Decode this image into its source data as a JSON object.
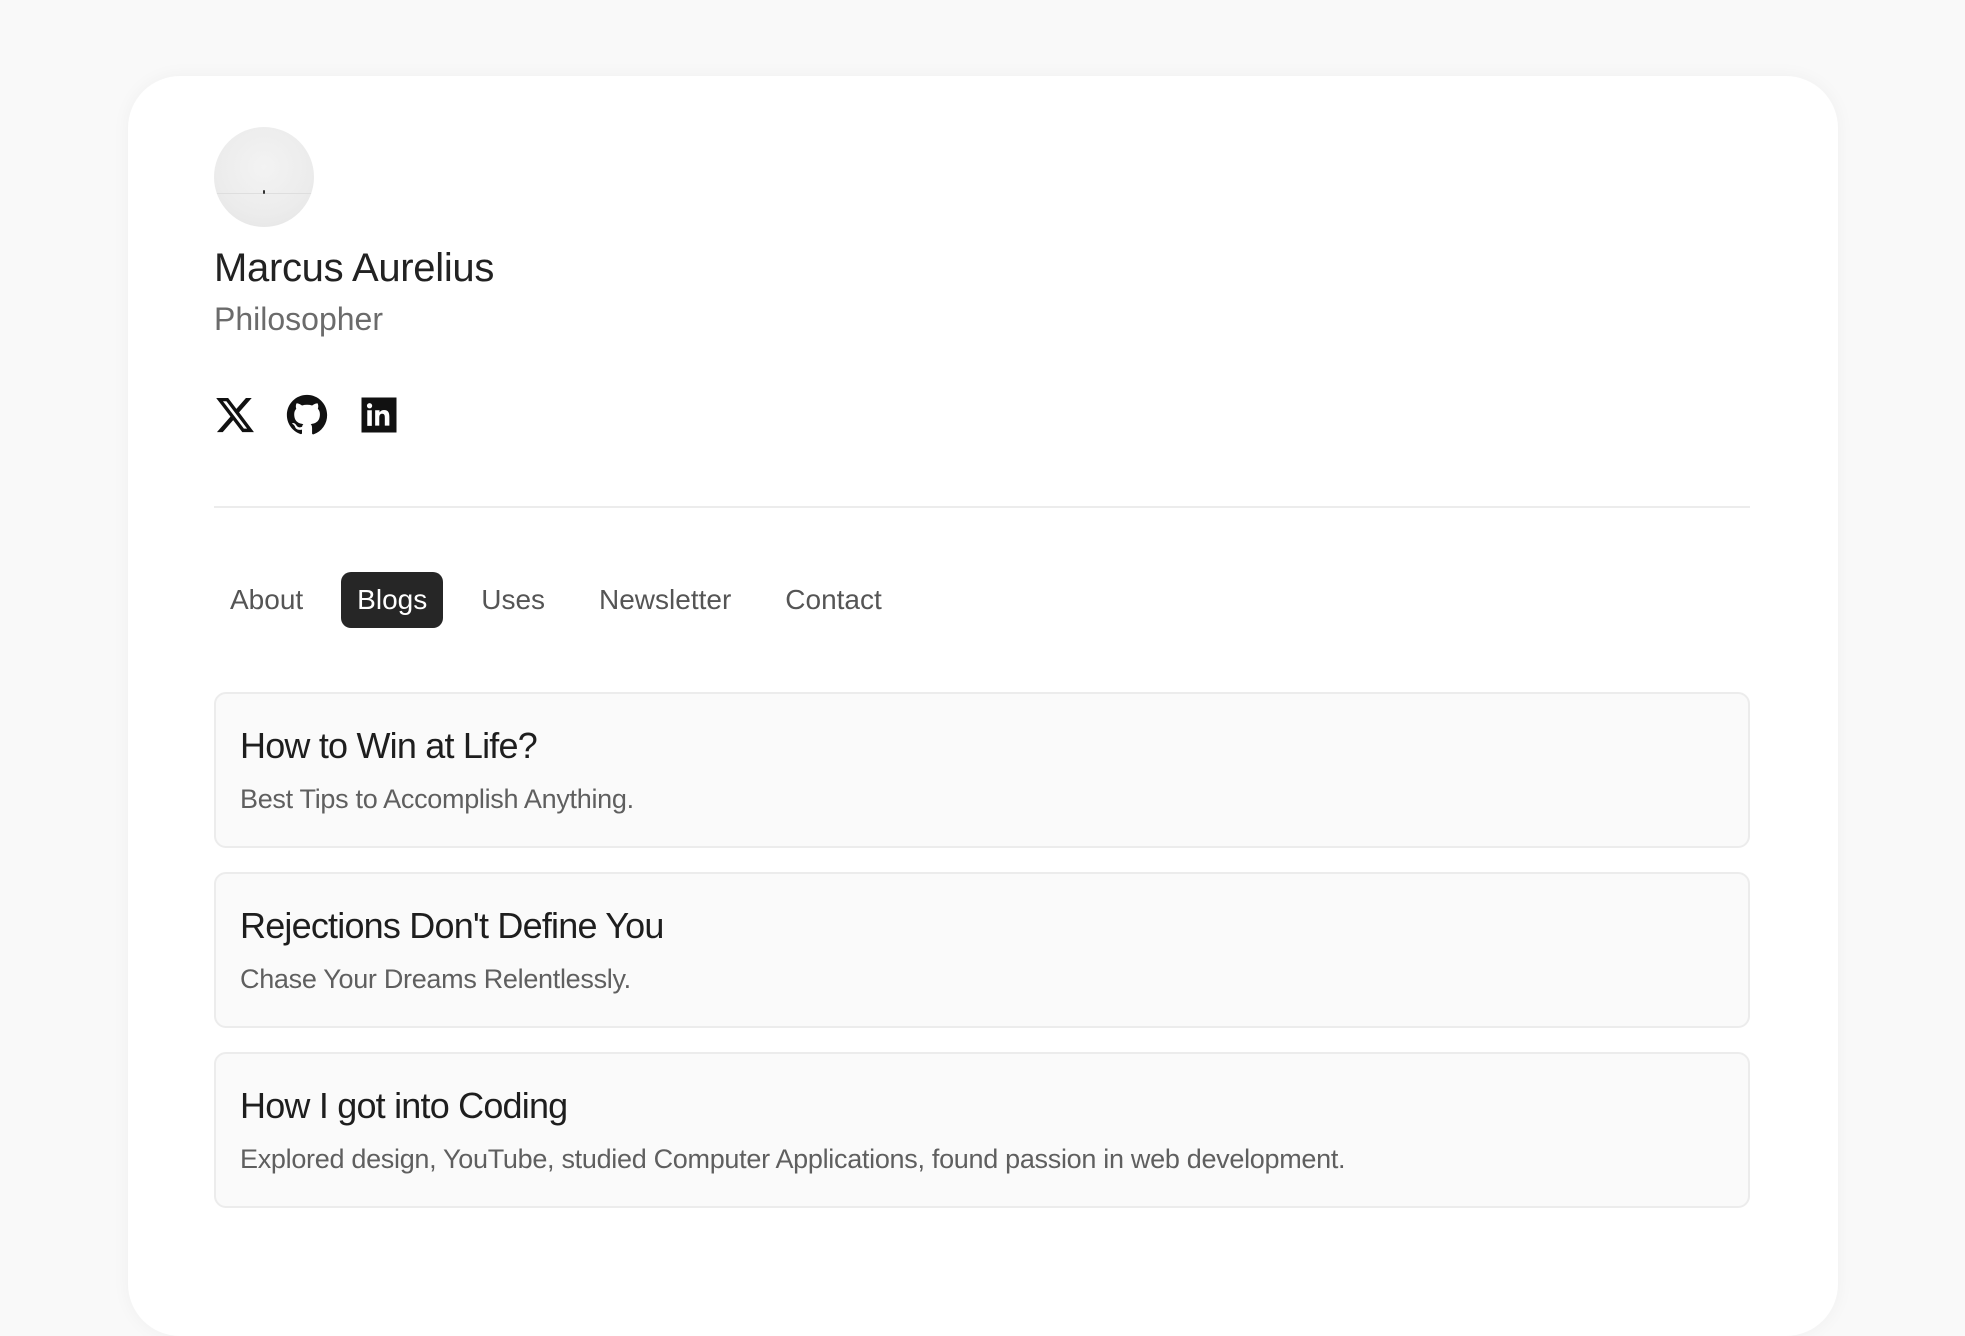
{
  "profile": {
    "name": "Marcus Aurelius",
    "role": "Philosopher"
  },
  "socials": [
    {
      "icon": "x-icon"
    },
    {
      "icon": "github-icon"
    },
    {
      "icon": "linkedin-icon"
    }
  ],
  "tabs": [
    {
      "label": "About",
      "active": false
    },
    {
      "label": "Blogs",
      "active": true
    },
    {
      "label": "Uses",
      "active": false
    },
    {
      "label": "Newsletter",
      "active": false
    },
    {
      "label": "Contact",
      "active": false
    }
  ],
  "posts": [
    {
      "title": "How to Win at Life?",
      "subtitle": "Best Tips to Accomplish Anything."
    },
    {
      "title": "Rejections Don't Define You",
      "subtitle": "Chase Your Dreams Relentlessly."
    },
    {
      "title": "How I got into Coding",
      "subtitle": "Explored design, YouTube, studied Computer Applications, found passion in web development."
    }
  ],
  "colors": {
    "page_background": "#f9f9f9",
    "card_background": "#ffffff",
    "active_tab": "#262626",
    "post_background": "#fafafa"
  }
}
